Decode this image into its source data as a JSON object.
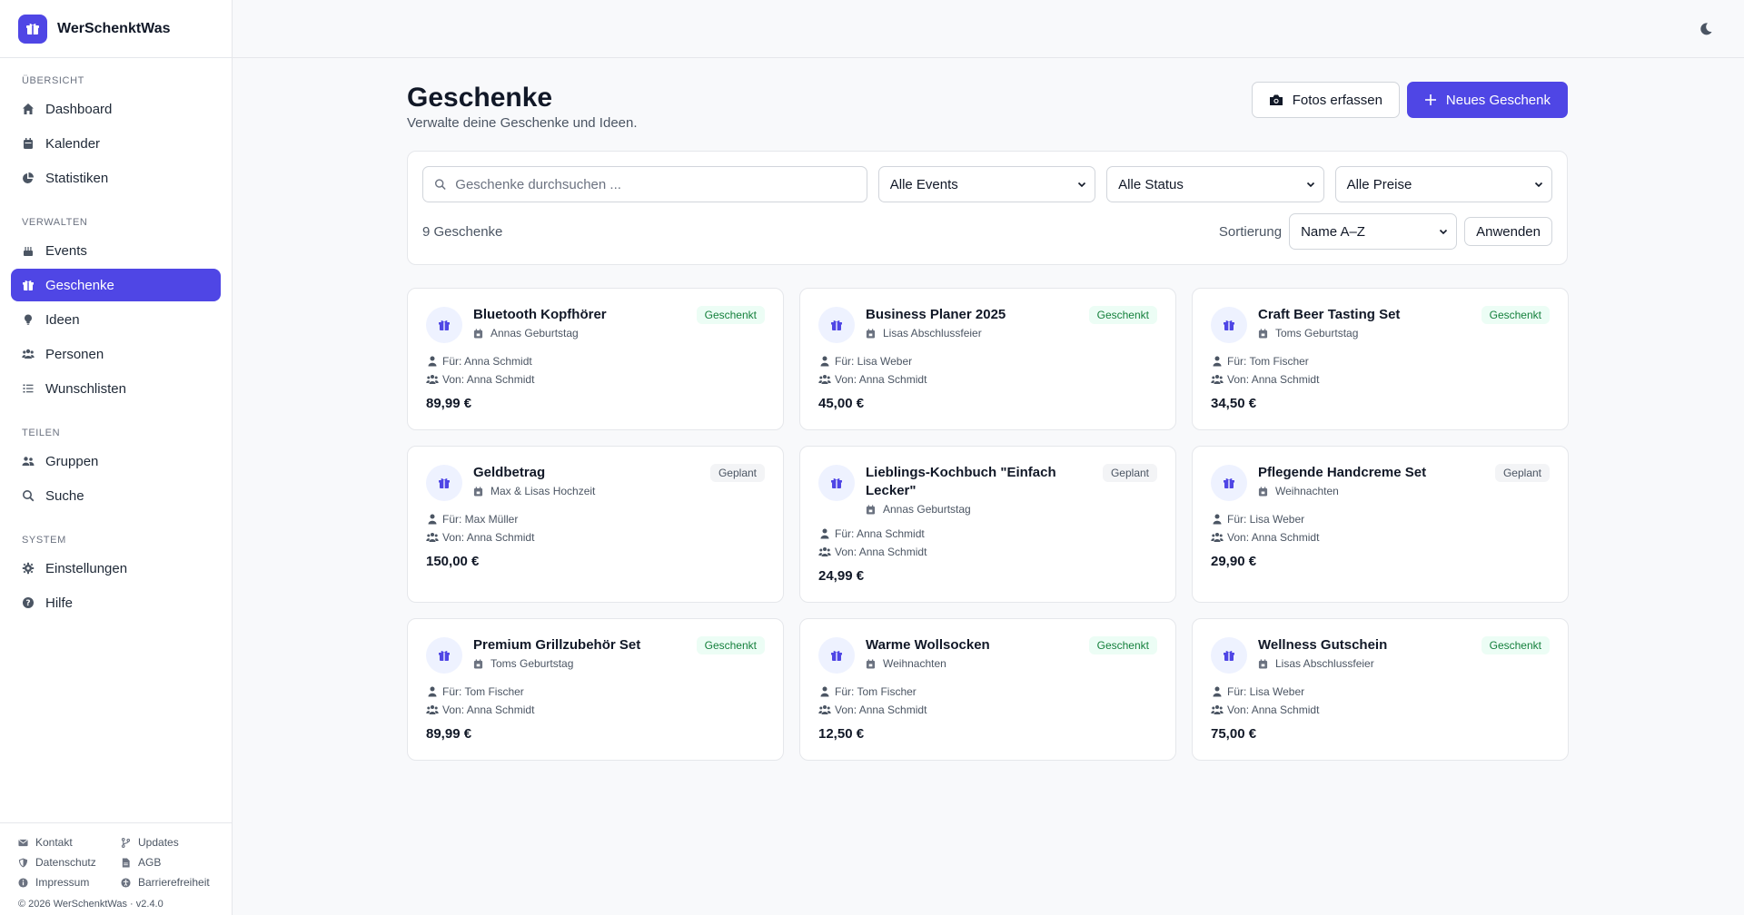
{
  "app": {
    "name": "WerSchenktWas"
  },
  "nav": {
    "sections": [
      {
        "heading": "Übersicht",
        "items": [
          {
            "label": "Dashboard",
            "icon": "home-icon"
          },
          {
            "label": "Kalender",
            "icon": "calendar-icon"
          },
          {
            "label": "Statistiken",
            "icon": "pie-chart-icon"
          }
        ]
      },
      {
        "heading": "Verwalten",
        "items": [
          {
            "label": "Events",
            "icon": "cake-icon"
          },
          {
            "label": "Geschenke",
            "icon": "gift-icon",
            "active": true
          },
          {
            "label": "Ideen",
            "icon": "lightbulb-icon"
          },
          {
            "label": "Personen",
            "icon": "users-icon"
          },
          {
            "label": "Wunschlisten",
            "icon": "list-icon"
          }
        ]
      },
      {
        "heading": "Teilen",
        "items": [
          {
            "label": "Gruppen",
            "icon": "group-icon"
          },
          {
            "label": "Suche",
            "icon": "search-icon"
          }
        ]
      },
      {
        "heading": "System",
        "items": [
          {
            "label": "Einstellungen",
            "icon": "gear-icon"
          },
          {
            "label": "Hilfe",
            "icon": "help-icon"
          }
        ]
      }
    ]
  },
  "footer": {
    "links": [
      {
        "label": "Kontakt",
        "icon": "mail-icon"
      },
      {
        "label": "Updates",
        "icon": "branch-icon"
      },
      {
        "label": "Datenschutz",
        "icon": "shield-icon"
      },
      {
        "label": "AGB",
        "icon": "document-icon"
      },
      {
        "label": "Impressum",
        "icon": "info-icon"
      },
      {
        "label": "Barrierefreiheit",
        "icon": "accessibility-icon"
      }
    ],
    "copyright": "© 2026 WerSchenktWas · v2.4.0"
  },
  "page": {
    "title": "Geschenke",
    "subtitle": "Verwalte deine Geschenke und Ideen.",
    "photo_button": "Fotos erfassen",
    "new_button": "Neues Geschenk"
  },
  "filters": {
    "search_placeholder": "Geschenke durchsuchen ...",
    "events": "Alle Events",
    "status": "Alle Status",
    "prices": "Alle Preise",
    "count": "9 Geschenke",
    "sort_label": "Sortierung",
    "sort_value": "Name A–Z",
    "apply": "Anwenden"
  },
  "colors": {
    "accent": "#4f46e5",
    "gifted": "#15803d",
    "planned": "#4b5563"
  },
  "gifts": [
    {
      "title": "Bluetooth Kopfhörer",
      "event": "Annas Geburtstag",
      "for": "Für: Anna Schmidt",
      "from": "Von: Anna Schmidt",
      "price": "89,99 €",
      "status": "Geschenkt"
    },
    {
      "title": "Business Planer 2025",
      "event": "Lisas Abschlussfeier",
      "for": "Für: Lisa Weber",
      "from": "Von: Anna Schmidt",
      "price": "45,00 €",
      "status": "Geschenkt"
    },
    {
      "title": "Craft Beer Tasting Set",
      "event": "Toms Geburtstag",
      "for": "Für: Tom Fischer",
      "from": "Von: Anna Schmidt",
      "price": "34,50 €",
      "status": "Geschenkt"
    },
    {
      "title": "Geldbetrag",
      "event": "Max & Lisas Hochzeit",
      "for": "Für: Max Müller",
      "from": "Von: Anna Schmidt",
      "price": "150,00 €",
      "status": "Geplant"
    },
    {
      "title": "Lieblings-Kochbuch \"Einfach Lecker\"",
      "event": "Annas Geburtstag",
      "for": "Für: Anna Schmidt",
      "from": "Von: Anna Schmidt",
      "price": "24,99 €",
      "status": "Geplant"
    },
    {
      "title": "Pflegende Handcreme Set",
      "event": "Weihnachten",
      "for": "Für: Lisa Weber",
      "from": "Von: Anna Schmidt",
      "price": "29,90 €",
      "status": "Geplant"
    },
    {
      "title": "Premium Grillzubehör Set",
      "event": "Toms Geburtstag",
      "for": "Für: Tom Fischer",
      "from": "Von: Anna Schmidt",
      "price": "89,99 €",
      "status": "Geschenkt"
    },
    {
      "title": "Warme Wollsocken",
      "event": "Weihnachten",
      "for": "Für: Tom Fischer",
      "from": "Von: Anna Schmidt",
      "price": "12,50 €",
      "status": "Geschenkt"
    },
    {
      "title": "Wellness Gutschein",
      "event": "Lisas Abschlussfeier",
      "for": "Für: Lisa Weber",
      "from": "Von: Anna Schmidt",
      "price": "75,00 €",
      "status": "Geschenkt"
    }
  ]
}
